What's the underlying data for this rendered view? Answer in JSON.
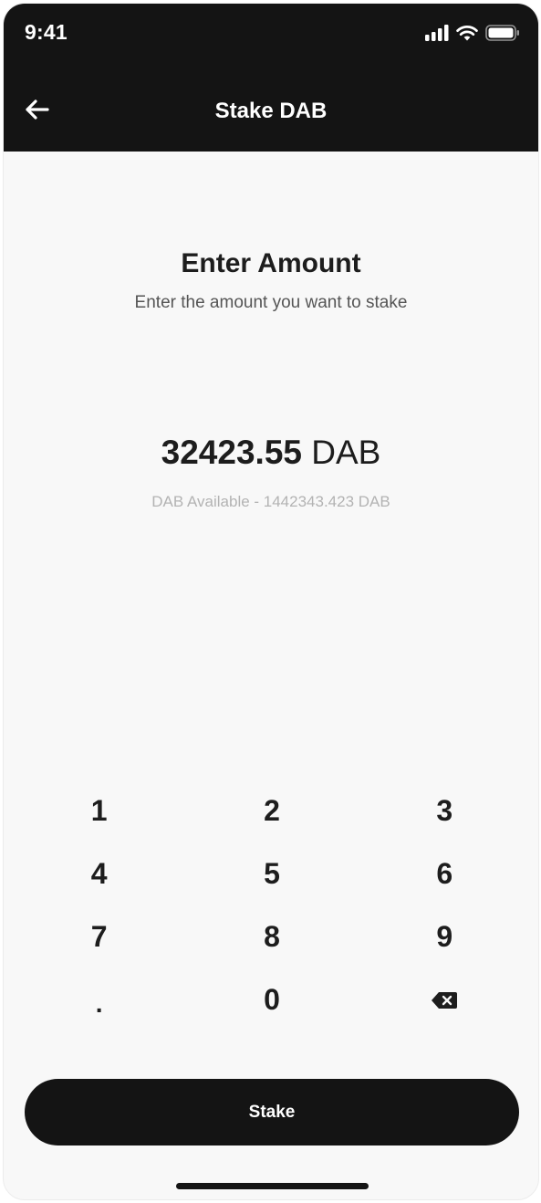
{
  "status_bar": {
    "time": "9:41",
    "icons": [
      "signal-icon",
      "wifi-icon",
      "battery-icon"
    ]
  },
  "header": {
    "title": "Stake DAB",
    "back_icon": "arrow-left-icon"
  },
  "main": {
    "heading": "Enter Amount",
    "subheading": "Enter the amount you want to stake",
    "amount_value": "32423.55",
    "amount_unit": "DAB",
    "available_text": "DAB Available - 1442343.423 DAB"
  },
  "keypad": {
    "keys": [
      "1",
      "2",
      "3",
      "4",
      "5",
      "6",
      "7",
      "8",
      "9",
      ".",
      "0"
    ],
    "backspace_icon": "backspace-icon"
  },
  "action": {
    "stake_label": "Stake"
  },
  "colors": {
    "dark": "#141414",
    "background": "#f8f8f8",
    "muted_text": "#b3b3b3"
  }
}
